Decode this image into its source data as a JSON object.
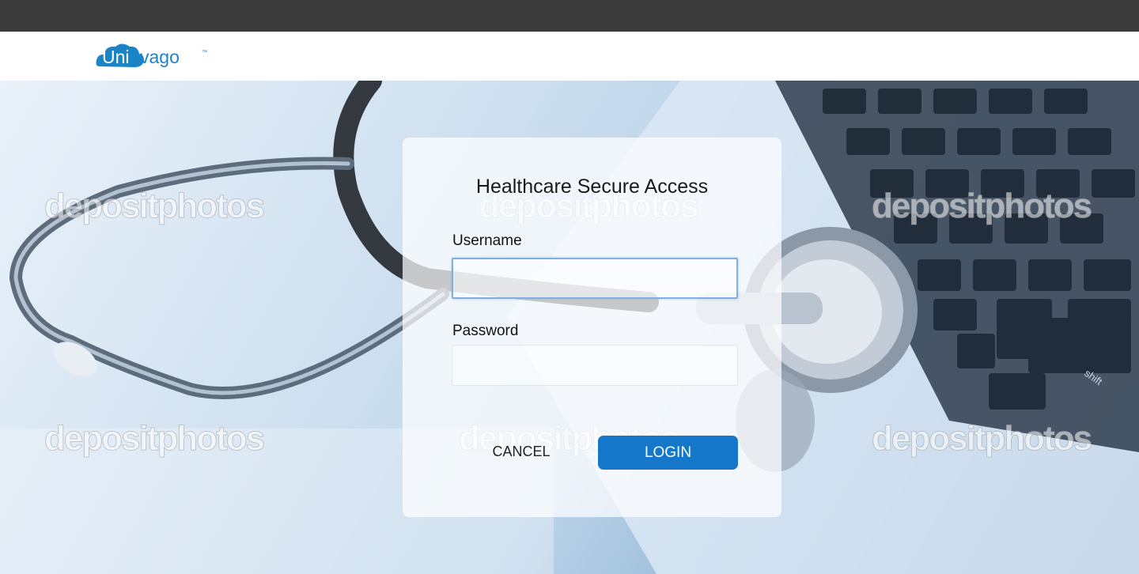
{
  "brand": {
    "name_part1": "Uni",
    "name_part2": "vago",
    "trademark": "™",
    "color": "#1b84c6"
  },
  "login": {
    "title": "Healthcare Secure Access",
    "username_label": "Username",
    "username_value": "",
    "password_label": "Password",
    "password_value": "",
    "cancel_label": "CANCEL",
    "login_label": "LOGIN",
    "accent_color": "#1477c9"
  },
  "background": {
    "watermark_text": "depositphotos",
    "keyboard_key_label": "shift"
  }
}
